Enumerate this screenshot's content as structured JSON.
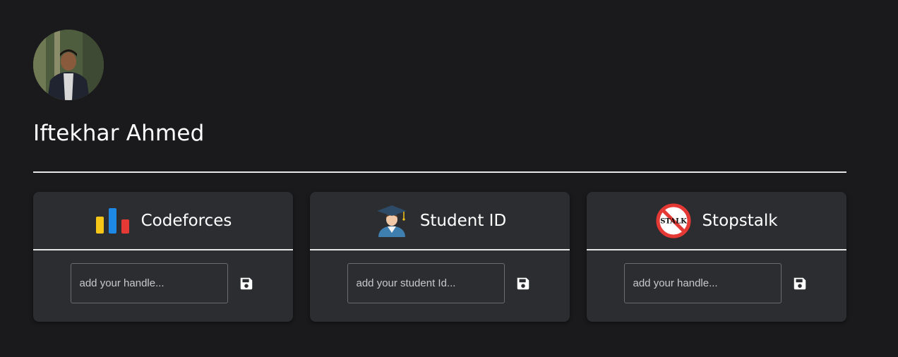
{
  "profile": {
    "name": "Iftekhar Ahmed"
  },
  "cards": [
    {
      "title": "Codeforces",
      "placeholder": "add your handle...",
      "icon": "bar-chart-icon"
    },
    {
      "title": "Student ID",
      "placeholder": "add your student Id...",
      "icon": "graduate-icon"
    },
    {
      "title": "Stopstalk",
      "placeholder": "add your handle...",
      "icon": "stopstalk-icon",
      "icon_text": "STALK"
    }
  ],
  "colors": {
    "background": "#1a1a1c",
    "card": "#2c2d30",
    "divider": "#e6e6e6",
    "codeforces_yellow": "#f5c518",
    "codeforces_blue": "#1e88e5",
    "codeforces_red": "#e53935",
    "stopstalk_red": "#e53935"
  }
}
